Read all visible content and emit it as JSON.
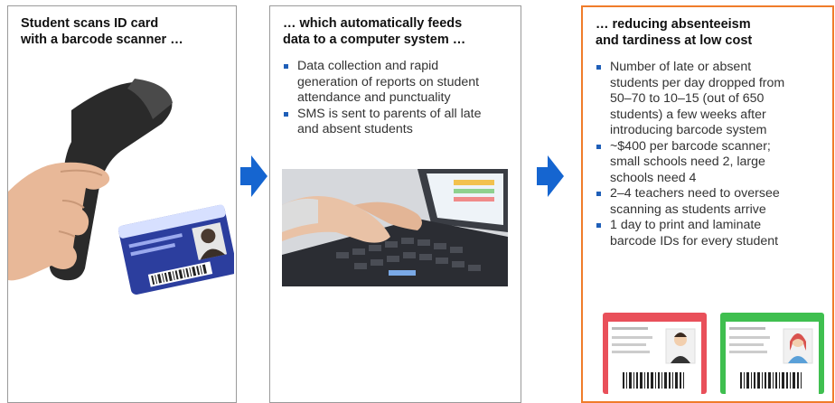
{
  "panels": [
    {
      "title_lines": [
        "Student scans ID card",
        "with a barcode scanner …"
      ],
      "image": "barcode-scanner-and-student-id-card"
    },
    {
      "title_lines": [
        "… which automatically feeds",
        "data to a computer system …"
      ],
      "bullets": [
        {
          "lines": [
            "Data collection and rapid",
            "generation of reports on student",
            "attendance and punctuality"
          ]
        },
        {
          "lines": [
            "SMS is sent to parents of all late",
            "and absent students"
          ]
        }
      ],
      "image": "hands-typing-on-laptop"
    },
    {
      "title_lines": [
        "… reducing absenteeism",
        "and tardiness at low cost"
      ],
      "bullets": [
        {
          "lines": [
            "Number of late or absent",
            "students per day dropped from",
            "50–70 to 10–15 (out of 650",
            "students) a few weeks after",
            "introducing barcode system"
          ]
        },
        {
          "lines": [
            "~$400 per barcode scanner;",
            "small schools need 2, large",
            "schools need 4"
          ]
        },
        {
          "lines": [
            "2–4 teachers need to oversee",
            "scanning as students arrive"
          ]
        },
        {
          "lines": [
            "1 day to print and laminate",
            "barcode IDs for every student"
          ]
        }
      ],
      "image": "sample-barcode-id-cards"
    }
  ],
  "colors": {
    "arrow": "#1565d0",
    "highlight_border": "#f07c2a",
    "bullet": "#1f5fb8"
  },
  "icons": [
    "right-arrow-icon",
    "right-arrow-icon"
  ]
}
